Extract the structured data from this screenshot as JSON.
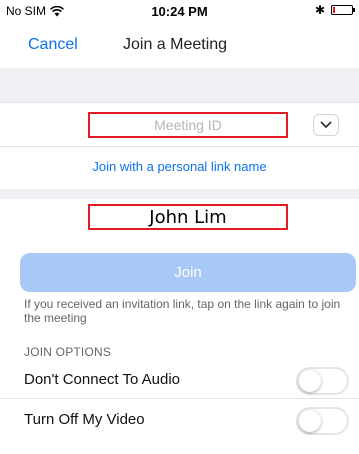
{
  "status_bar": {
    "carrier": "No SIM",
    "time": "10:24 PM",
    "battery_level": 0.1,
    "battery_color": "#e02020"
  },
  "nav": {
    "cancel_label": "Cancel",
    "title": "Join a Meeting"
  },
  "meeting_id": {
    "placeholder": "Meeting ID",
    "value": ""
  },
  "personal_link_label": "Join with a personal link name",
  "name_field": {
    "value": "John Lim"
  },
  "join": {
    "label": "Join",
    "note": "If you received an invitation link, tap on the link again to join the meeting"
  },
  "join_options": {
    "header": "JOIN OPTIONS",
    "items": [
      {
        "label": "Don't Connect To Audio",
        "enabled": false
      },
      {
        "label": "Turn Off My Video",
        "enabled": false
      }
    ]
  },
  "colors": {
    "accent": "#0e72ed",
    "join_button": "#a8c8f5",
    "highlight_box": "#e01b24"
  },
  "icons": [
    "wifi-icon",
    "bluetooth-icon",
    "battery-icon",
    "chevron-down-icon"
  ]
}
